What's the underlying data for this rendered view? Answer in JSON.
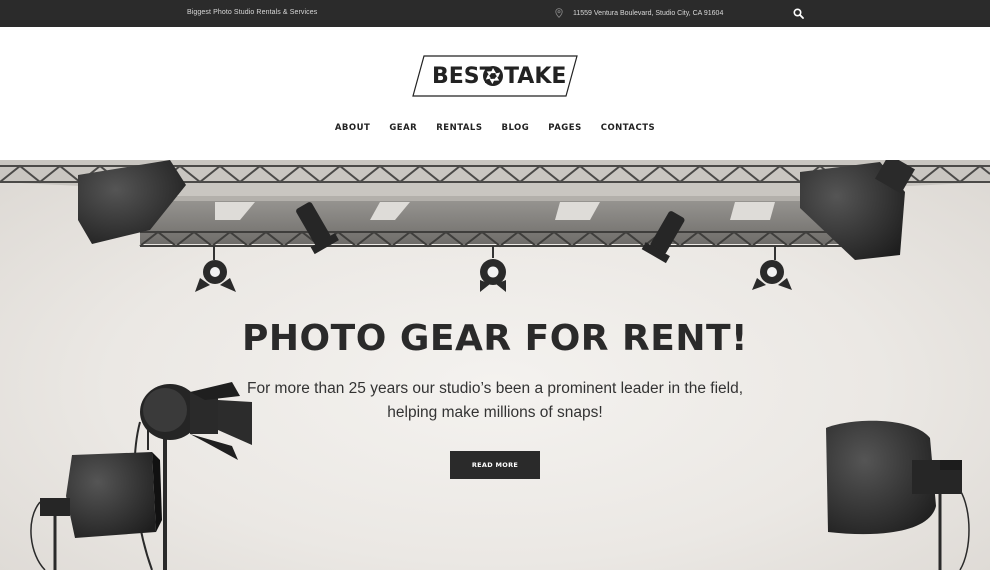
{
  "topbar": {
    "tagline": "Biggest Photo Studio Rentals & Services",
    "address": "11559 Ventura Boulevard, Studio City, CA 91604",
    "address_icon": "map-pin-icon",
    "search_icon": "search-icon"
  },
  "logo": {
    "word_left": "BEST",
    "word_right": "TAKE",
    "mark_icon": "aperture-icon"
  },
  "nav": {
    "items": [
      "ABOUT",
      "GEAR",
      "RENTALS",
      "BLOG",
      "PAGES",
      "CONTACTS"
    ]
  },
  "hero": {
    "title": "PHOTO GEAR FOR RENT!",
    "text": "For more than 25 years our studio’s been a prominent leader in the field, helping make millions of snaps!",
    "button_label": "READ MORE"
  },
  "colors": {
    "topbar_bg": "#2b2b2b",
    "text_dark": "#2a2a2a",
    "button_bg": "#2a2a2a",
    "hero_bg": "#ebe8e4"
  }
}
